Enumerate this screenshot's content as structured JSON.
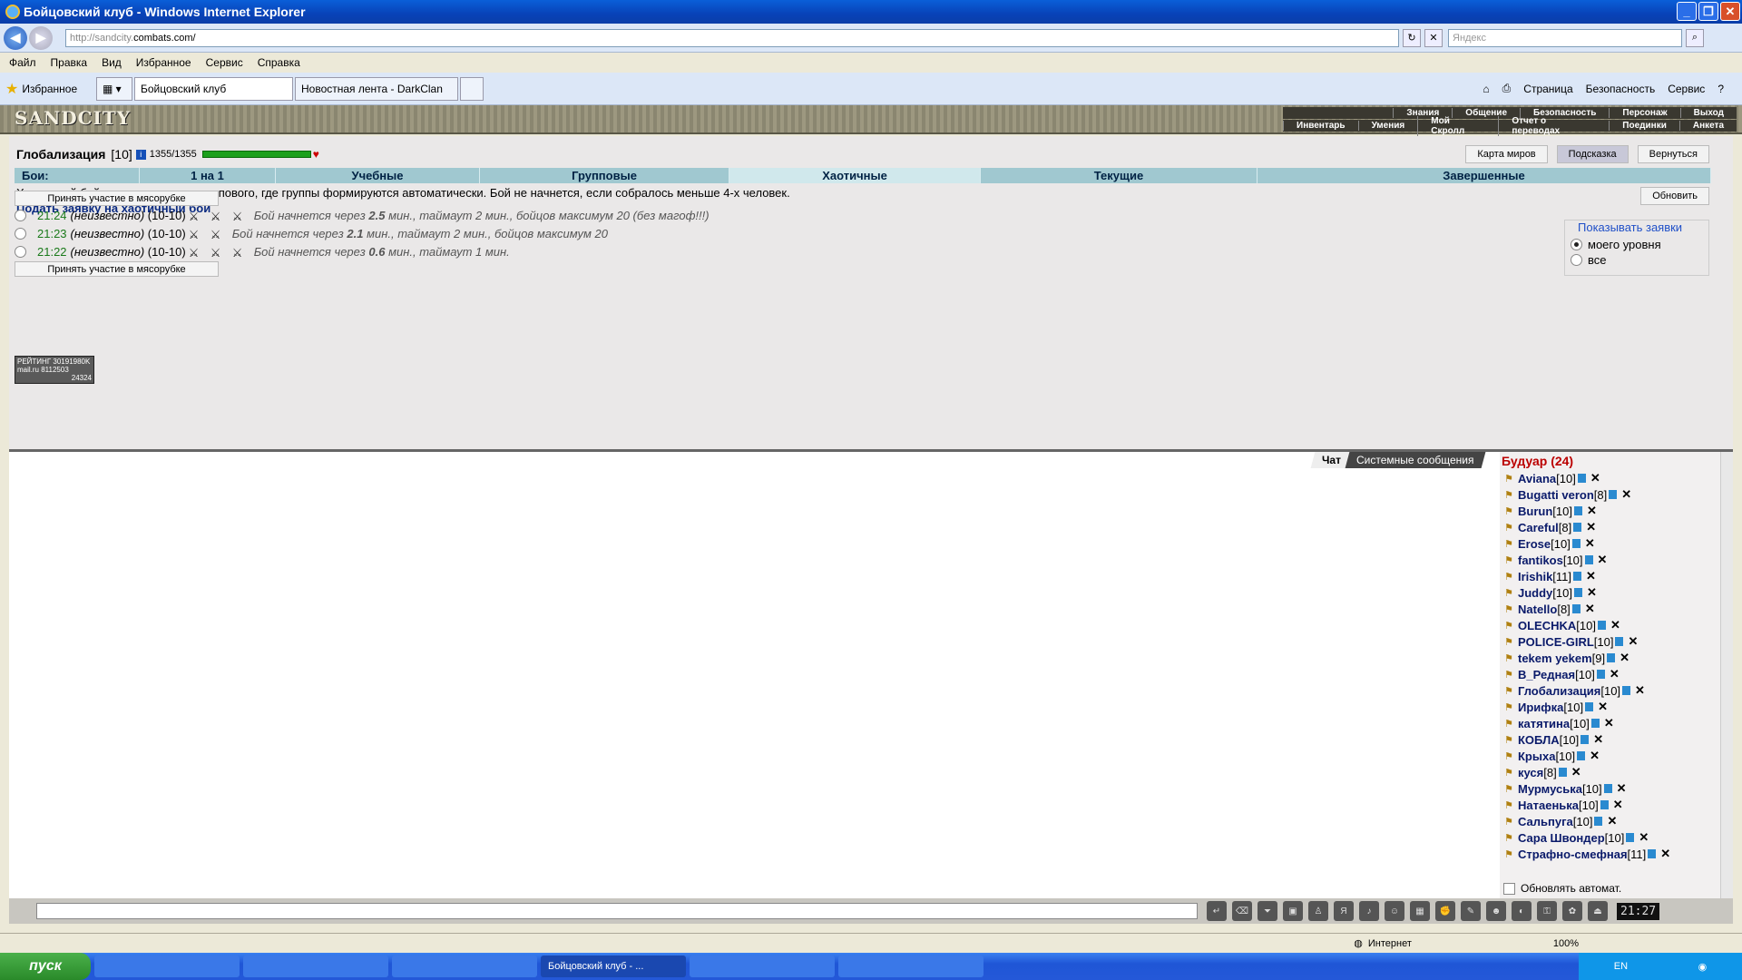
{
  "window": {
    "title": "Бойцовский клуб - Windows Internet Explorer"
  },
  "address": {
    "url_prefix": "http://sandcity.",
    "url_domain": "combats.com/",
    "search_placeholder": "Яндекс"
  },
  "menu": [
    "Файл",
    "Правка",
    "Вид",
    "Избранное",
    "Сервис",
    "Справка"
  ],
  "favorites_label": "Избранное",
  "tabs": [
    {
      "label": "Бойцовский клуб"
    },
    {
      "label": "Новостная лента - DarkClan"
    }
  ],
  "tab_tools": [
    "Страница",
    "Безопасность",
    "Сервис"
  ],
  "game": {
    "logo": "SANDCITY",
    "topnav_row1": [
      "Знания",
      "Общение",
      "Безопасность",
      "Персонаж",
      "Выход"
    ],
    "topnav_row2": [
      "Инвентарь",
      "Умения",
      "Мой Скролл",
      "Отчет о переводах",
      "Поединки",
      "Анкета"
    ],
    "player_name": "Глобализация",
    "player_level": "[10]",
    "hp": "1355/1355",
    "top_buttons": [
      "Карта миров",
      "Подсказка",
      "Вернуться"
    ],
    "tabs": [
      "Бои:",
      "1 на 1",
      "Учебные",
      "Групповые",
      "Хаотичные",
      "Текущие",
      "Завершенные"
    ],
    "description": "Хаотичный бой - разновидность группового, где группы формируются автоматически. Бой не начнется, если собралось меньше 4-х человек.",
    "apply_link": "Подать заявку на хаотичный бой",
    "refresh_button": "Обновить",
    "show_requests": {
      "legend": "Показывать заявки",
      "opt1": "моего уровня",
      "opt2": "все"
    },
    "join_button": "Принять участие в мясорубке",
    "battles": [
      {
        "time": "21:24",
        "who": "(неизвестно)",
        "range": "(10-10)",
        "pre": "Бой начнется через ",
        "mins": "2.5",
        "post": " мин., таймаут 2 мин., бойцов максимум 20 (без магоф!!!)"
      },
      {
        "time": "21:23",
        "who": "(неизвестно)",
        "range": "(10-10)",
        "pre": "Бой начнется через ",
        "mins": "2.1",
        "post": " мин., таймаут 2 мин., бойцов максимум 20"
      },
      {
        "time": "21:22",
        "who": "(неизвестно)",
        "range": "(10-10)",
        "pre": "Бой начнется через ",
        "mins": "0.6",
        "post": " мин., таймаут 1 мин."
      }
    ],
    "rating": {
      "line1": "РЕЙТИНГ 30191980K",
      "line2": "mail.ru 8112503",
      "line3": "24324"
    }
  },
  "chat": {
    "tab_chat": "Чат",
    "tab_system": "Системные сообщения"
  },
  "room": {
    "title": "Будуар (24)",
    "users": [
      {
        "name": "Aviana",
        "level": "[10]"
      },
      {
        "name": "Bugatti veron",
        "level": "[8]"
      },
      {
        "name": "Burun",
        "level": "[10]"
      },
      {
        "name": "Careful",
        "level": "[8]"
      },
      {
        "name": "Erose",
        "level": "[10]"
      },
      {
        "name": "fantikos",
        "level": "[10]"
      },
      {
        "name": "Irishik",
        "level": "[11]"
      },
      {
        "name": "Juddy",
        "level": "[10]"
      },
      {
        "name": "Natello",
        "level": "[8]"
      },
      {
        "name": "OLECHKA",
        "level": "[10]"
      },
      {
        "name": "POLICE-GIRL",
        "level": "[10]"
      },
      {
        "name": "tekem yekem",
        "level": "[9]"
      },
      {
        "name": "В_Редная",
        "level": "[10]"
      },
      {
        "name": "Глобализация",
        "level": "[10]"
      },
      {
        "name": "Ирифка",
        "level": "[10]"
      },
      {
        "name": "катятина",
        "level": "[10]"
      },
      {
        "name": "КОБЛА",
        "level": "[10]"
      },
      {
        "name": "Крыха",
        "level": "[10]"
      },
      {
        "name": "куся",
        "level": "[8]"
      },
      {
        "name": "Мурмуська",
        "level": "[10]"
      },
      {
        "name": "Натаенька",
        "level": "[10]"
      },
      {
        "name": "Сальпуга",
        "level": "[10]"
      },
      {
        "name": "Сара Швондер",
        "level": "[10]"
      },
      {
        "name": "Страфно-смефная",
        "level": "[11]"
      }
    ],
    "auto_refresh": "Обновлять автомат."
  },
  "clock": "21:27",
  "status": {
    "zone": "Интернет",
    "zoom": "100%"
  },
  "taskbar": {
    "start": "пуск",
    "task_active": "Бойцовский клуб - ...",
    "lang": "EN"
  }
}
